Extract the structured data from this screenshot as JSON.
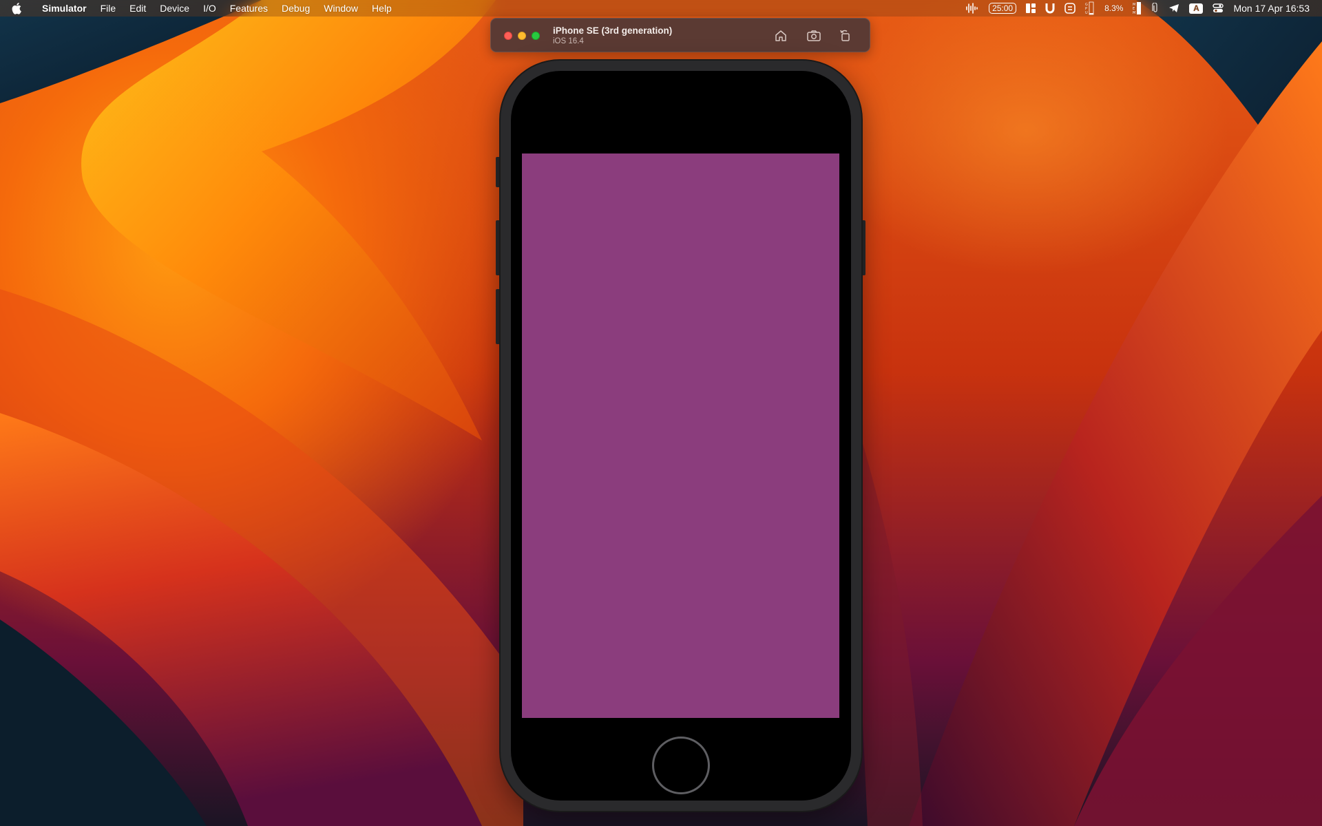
{
  "menubar": {
    "apple_icon": "apple-logo-icon",
    "app_name": "Simulator",
    "items": [
      "File",
      "Edit",
      "Device",
      "I/O",
      "Features",
      "Debug",
      "Window",
      "Help"
    ],
    "status": {
      "audio_icon": "waveform-icon",
      "timer": "25:00",
      "layout_icon": "window-layout-icon",
      "u_icon": "u-logo-icon",
      "sync_icon": "sync-icon",
      "gpu_icon": "gpu-meter-icon",
      "cpu_percent": "8.3%",
      "memory_icon": "memory-meter-icon",
      "paperclip_icon": "paperclip-icon",
      "telegram_icon": "telegram-icon",
      "input_source": "A",
      "control_center_icon": "control-center-icon",
      "datetime": "Mon 17 Apr  16:53"
    }
  },
  "simulator": {
    "device_name": "iPhone SE (3rd generation)",
    "os_version": "iOS 16.4",
    "toolbar": {
      "home_icon": "home-icon",
      "screenshot_icon": "camera-icon",
      "rotate_icon": "rotate-icon"
    },
    "screen_color": "#8b3d7d"
  },
  "colors": {
    "close": "#fe5f57",
    "minimize": "#febc2e",
    "zoom": "#28c840",
    "titlebar": "#5b3a33"
  }
}
